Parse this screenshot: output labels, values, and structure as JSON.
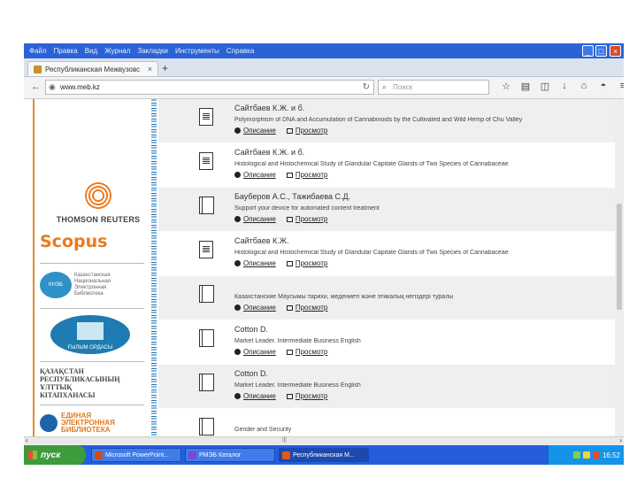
{
  "menu": [
    "Файл",
    "Правка",
    "Вид",
    "Журнал",
    "Закладки",
    "Инструменты",
    "Справка"
  ],
  "tab": {
    "title": "Республиканская Межвузовс",
    "close": "×",
    "new": "+"
  },
  "nav": {
    "back": "←",
    "url": "www.meb.kz",
    "reload": "↻",
    "search_placeholder": "Поиск"
  },
  "toolbar_icons": [
    "star-icon",
    "bookmarks-icon",
    "pocket-icon",
    "download-icon",
    "home-icon",
    "chat-icon",
    "menu-icon"
  ],
  "sidebar": {
    "thomson": "THOMSON REUTERS",
    "scopus": "Scopus",
    "kneb_oval": "КНЭБ",
    "kneb_text": [
      "Казахстанская",
      "Национальная",
      "Электронная",
      "Библиотека"
    ],
    "gylym": "ҒЫЛЫМ ОРДАСЫ",
    "kaz_library": [
      "ҚАЗАҚСТАН",
      "РЕСПУБЛИКАСЫНЫҢ",
      "ҰЛТТЫҚ",
      "КІТАПХАНАСЫ"
    ],
    "edin": [
      "ЕДИНАЯ",
      "ЭЛЕКТРОННАЯ",
      "БИБЛИОТЕКА"
    ]
  },
  "records": [
    {
      "author": "Сайтбаев К.Ж. и б.",
      "title": "Polymorphism of DNA and Accumulation of Cannabinoids by the Cultivated and Wild Hemp of Chu Valley",
      "icon": "paper",
      "shade": true
    },
    {
      "author": "Сайтбаев К.Ж. и б.",
      "title": "Histological and Histochemical Study of Glandular Capitate Glands of Two Species of Cannabaceae",
      "icon": "paper",
      "shade": false
    },
    {
      "author": "Бауберов А.С., Тажибаева С.Д.",
      "title": "Support your device for automated content treatment",
      "icon": "book",
      "shade": true
    },
    {
      "author": "Сайтбаев К.Ж.",
      "title": "Histological and Histochemical Study of Glandular Capitate Glands of Two Species of Cannabaceae",
      "icon": "paper",
      "shade": false
    },
    {
      "author": "",
      "title": "Казахстанские Маусымы тарихи, медениетi және этикалық негiздерi туралы",
      "icon": "book",
      "shade": true
    },
    {
      "author": "Cotton D.",
      "title": "Market Leader. Intermediate Business English",
      "icon": "book",
      "shade": false
    },
    {
      "author": "Cotton D.",
      "title": "Market Leader. Intermediate Business English",
      "icon": "book",
      "shade": true
    },
    {
      "author": "",
      "title": "Gender and Security",
      "icon": "book",
      "shade": false
    }
  ],
  "links": {
    "describe": "Описание",
    "view": "Просмотр"
  },
  "taskbar": {
    "start": "пуск",
    "buttons": [
      "Microsoft PowerPoint...",
      "РМЭБ Каталог",
      "Республиканская М..."
    ],
    "clock": "16:52"
  },
  "colors": {
    "accent_blue": "#2b63d6",
    "sidebar_orange": "#e58a2a",
    "scopus_orange": "#e77a1e",
    "taskbar_blue": "#245edb"
  }
}
